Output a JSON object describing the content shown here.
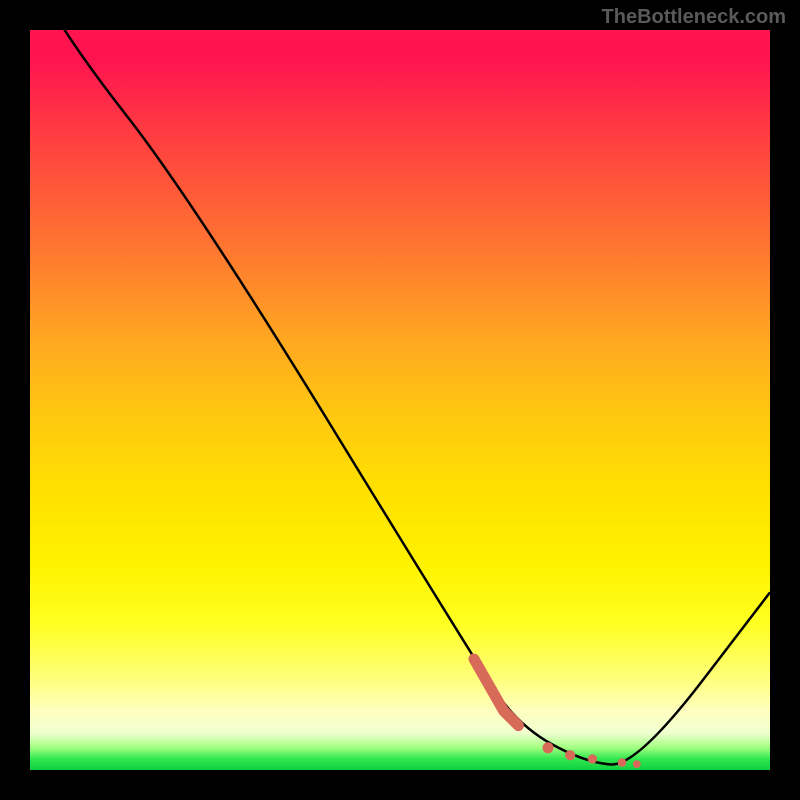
{
  "watermark": "TheBottleneck.com",
  "chart_data": {
    "type": "line",
    "title": "",
    "xlabel": "",
    "ylabel": "",
    "xlim": [
      0,
      100
    ],
    "ylim": [
      0,
      100
    ],
    "series": [
      {
        "name": "main-curve",
        "color": "#000000",
        "x": [
          0,
          4,
          22,
          60,
          66,
          75,
          82,
          100
        ],
        "y": [
          108,
          100,
          77,
          15,
          6,
          1,
          0.5,
          24
        ]
      },
      {
        "name": "highlight-segment",
        "color": "#d86a5a",
        "x": [
          60,
          64,
          66,
          70,
          73,
          76,
          80,
          82
        ],
        "y": [
          15,
          8,
          6,
          3,
          2,
          1.5,
          1,
          0.8
        ]
      }
    ],
    "gradient_stops": [
      {
        "pos": 0,
        "color": "#ff1450"
      },
      {
        "pos": 50,
        "color": "#ffc810"
      },
      {
        "pos": 80,
        "color": "#ffff20"
      },
      {
        "pos": 100,
        "color": "#10d040"
      }
    ]
  }
}
